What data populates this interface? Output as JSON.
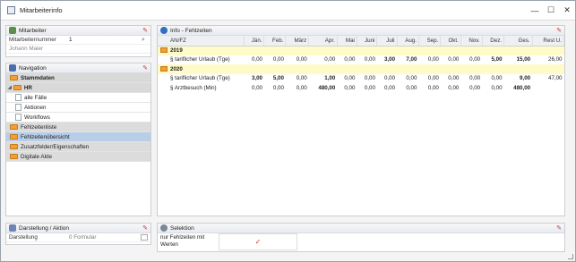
{
  "window": {
    "title": "Mitarbeiterinfo",
    "minimize": "—",
    "maximize": "☐",
    "close": "✕"
  },
  "mitarbeiter": {
    "title": "Mitarbeiter",
    "field_label": "Mitarbeiternummer",
    "field_value": "1",
    "name": "Johann Maier"
  },
  "navigation": {
    "title": "Navigation",
    "items": [
      {
        "label": "Stammdaten"
      },
      {
        "label": "HR"
      },
      {
        "label": "alle Fälle"
      },
      {
        "label": "Aktionen"
      },
      {
        "label": "Workflows"
      },
      {
        "label": "Fehlzeitenliste"
      },
      {
        "label": "Fehlzeitenübersicht"
      },
      {
        "label": "Zusatzfelder/Eigenschaften"
      },
      {
        "label": "Digitale Akte"
      }
    ]
  },
  "darstellung": {
    "title": "Darstellung / Aktion",
    "label": "Darstellung",
    "value": "0 Formular"
  },
  "info": {
    "title": "Info - Fehlzeiten",
    "columns": [
      "AN/FZ",
      "Jän.",
      "Feb.",
      "März",
      "Apr.",
      "Mai",
      "Juni",
      "Juli",
      "Aug.",
      "Sep.",
      "Okt.",
      "Nov.",
      "Dez.",
      "Ges.",
      "Rest U."
    ],
    "groups": [
      {
        "year": "2019",
        "rows": [
          {
            "label": "§ tariflicher Urlaub (Tge)",
            "values": [
              "0,00",
              "0,00",
              "0,00",
              "0,00",
              "0,00",
              "0,00",
              "3,00",
              "7,00",
              "0,00",
              "0,00",
              "0,00",
              "5,00",
              "15,00",
              "26,00"
            ]
          }
        ]
      },
      {
        "year": "2020",
        "rows": [
          {
            "label": "§ tariflicher Urlaub (Tge)",
            "values": [
              "3,00",
              "5,00",
              "0,00",
              "1,00",
              "0,00",
              "0,00",
              "0,00",
              "0,00",
              "0,00",
              "0,00",
              "0,00",
              "0,00",
              "9,00",
              "47,00"
            ]
          },
          {
            "label": "§ Arztbesuch (Min)",
            "values": [
              "0,00",
              "0,00",
              "0,00",
              "480,00",
              "0,00",
              "0,00",
              "0,00",
              "0,00",
              "0,00",
              "0,00",
              "0,00",
              "0,00",
              "480,00",
              ""
            ]
          }
        ]
      }
    ]
  },
  "selektion": {
    "title": "Selektion",
    "option_label": "nur Fehlzeiten mit Werten",
    "option_checked": "✓"
  },
  "colors": {
    "accent": "#b7cde8",
    "year_row": "#fffbc8",
    "folder": "#f0a035",
    "pin": "#cc3333"
  }
}
